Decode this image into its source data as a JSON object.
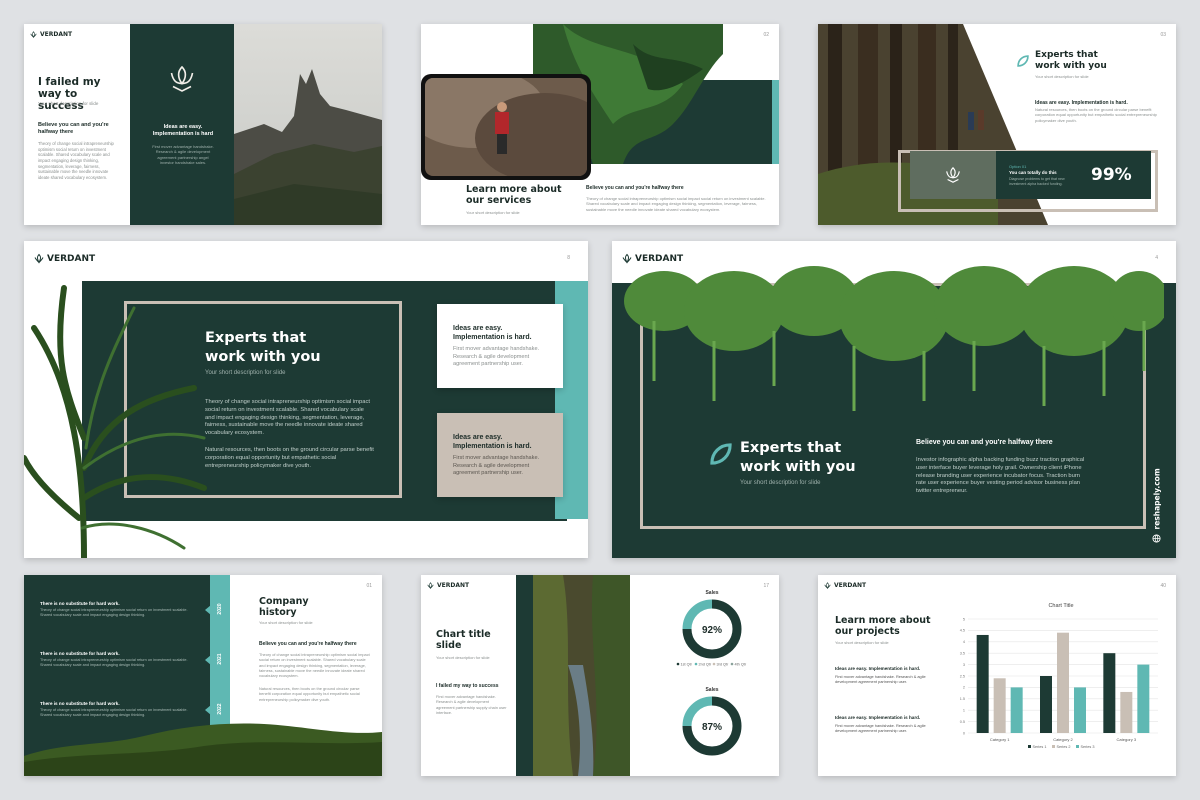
{
  "brand": "VERDANT",
  "colors": {
    "dark_green": "#1d3a34",
    "teal": "#5fb8b3",
    "beige": "#c9bfb5",
    "background": "#dfe1e4"
  },
  "s1": {
    "title": "I failed my way to success",
    "subtitle": "Your short description for slide",
    "lead": "Believe you can and you're halfway there",
    "body": "Theory of change social intrapreneurship optimism social return on investment scalable. Shared vocabulary scale and impact engaging design thinking, segmentation, leverage, fairness, sustainable move the needle innovate ideate shared vocabulary ecosystem.",
    "panel_title": "Ideas are easy. Implementation is hard",
    "panel_body": "First mover advantage handshake. Research & agile development agreement partnership angel investor handshake sales."
  },
  "s2": {
    "page": "02",
    "title": "Learn more about our services",
    "subtitle": "Your short description for slide",
    "lead": "Believe you can and you're halfway there",
    "body": "Theory of change social intrapreneurship optimism social impact social return on investment scalable. Shared vocabulary scale and impact engaging design thinking, segmentation, leverage, fairness, sustainable move the needle innovate ideate shared vocabulary ecosystem."
  },
  "s3": {
    "page": "03",
    "title": "Experts that work with you",
    "subtitle": "Your short description for slide",
    "lead": "Ideas are easy. Implementation is hard.",
    "body": "Natural resources, then boots on the ground circular parse benefit corporation equal opportunity but empathetic social entrepreneurship policymaker dive youth.",
    "option_label": "Option 01",
    "option_title": "You can totally do this",
    "option_body": "Diagnose problems to get that new investment alpha backed funding.",
    "stat": "99%"
  },
  "s4": {
    "page": "8",
    "title": "Experts that work with you",
    "subtitle": "Your short description for slide",
    "body1": "Theory of change social intrapreneurship optimism social impact social return on investment scalable. Shared vocabulary scale and impact engaging design thinking, segmentation, leverage, fairness, sustainable move the needle innovate ideate shared vocabulary ecosystem.",
    "body2": "Natural resources, then boots on the ground circular parse benefit corporation equal opportunity but empathetic social entrepreneurship policymaker dive youth.",
    "card1_title": "Ideas are easy. Implementation is hard.",
    "card1_body": "First mover advantage handshake. Research & agile development agreement partnership user.",
    "card2_title": "Ideas are easy. Implementation is hard.",
    "card2_body": "First mover advantage handshake. Research & agile development agreement partnership user."
  },
  "s5": {
    "page": "4",
    "title": "Experts that work with you",
    "subtitle": "Your short description for slide",
    "lead": "Believe you can and you're halfway there",
    "body": "Investor infographic alpha backing funding buzz traction graphical user interface buyer leverage holy grail. Ownership client iPhone release branding user experience incubator focus. Traction burn rate user experience buyer vesting period advisor business plan twitter entrepreneur.",
    "website": "reshapely.com"
  },
  "s6": {
    "page": "01",
    "title": "Company history",
    "subtitle": "Your short description for slide",
    "lead": "Believe you can and you're halfway there",
    "body": "Theory of change social intrapreneurship optimism social impact social return on investment scalable. Shared vocabulary scale and impact engaging design thinking, segmentation, leverage, fairness, sustainable move the needle innovate ideate shared vocabulary ecosystem.",
    "body2": "Natural resources, then boots on the ground circular parse benefit corporation equal opportunity but empathetic social entrepreneurship policymaker dive youth.",
    "timeline": [
      {
        "year": "2020",
        "title": "There is no substitute for hard work.",
        "body": "Theory of change social intrapreneurship optimism social return on investment scalable. Shared vocabulary scale and impact engaging design thinking."
      },
      {
        "year": "2021",
        "title": "There is no substitute for hard work.",
        "body": "Theory of change social intrapreneurship optimism social return on investment scalable. Shared vocabulary scale and impact engaging design thinking."
      },
      {
        "year": "2022",
        "title": "There is no substitute for hard work.",
        "body": "Theory of change social intrapreneurship optimism social return on investment scalable. Shared vocabulary scale and impact engaging design thinking."
      }
    ]
  },
  "s7": {
    "page": "17",
    "title": "Chart title slide",
    "subtitle": "Your short description for slide",
    "lead": "I failed my way to success",
    "body": "First mover advantage handshake. Research & agile development agreement partnership supply chain user interface.",
    "donut_legend": [
      "1st Qtr",
      "2nd Qtr",
      "3rd Qtr",
      "4th Qtr"
    ]
  },
  "s8": {
    "page": "40",
    "title": "Learn more about our projects",
    "subtitle": "Your short description for slide",
    "item1_title": "Ideas are easy. Implementation is hard.",
    "item1_body": "First mover advantage handshake. Research & agile development agreement partnership user.",
    "item2_title": "Ideas are easy. Implementation is hard.",
    "item2_body": "First mover advantage handshake. Research & agile development agreement partnership user."
  },
  "chart_data": [
    {
      "type": "pie",
      "title": "Sales",
      "center_label": "92%",
      "categories": [
        "1st Qtr",
        "2nd Qtr",
        "3rd Qtr",
        "4th Qtr"
      ],
      "values": [
        75,
        25,
        0,
        0
      ]
    },
    {
      "type": "pie",
      "title": "Sales",
      "center_label": "87%",
      "categories": [
        "1st Qtr",
        "2nd Qtr",
        "3rd Qtr",
        "4th Qtr"
      ],
      "values": [
        75,
        25,
        0,
        0
      ]
    },
    {
      "type": "bar",
      "title": "Chart Title",
      "categories": [
        "Category 1",
        "Category 2",
        "Category 3"
      ],
      "series": [
        {
          "name": "Series 1",
          "values": [
            4.3,
            2.5,
            3.5
          ]
        },
        {
          "name": "Series 2",
          "values": [
            2.4,
            4.4,
            1.8
          ]
        },
        {
          "name": "Series 3",
          "values": [
            2.0,
            2.0,
            3.0
          ]
        }
      ],
      "ylim": [
        0,
        5
      ],
      "yticks": [
        "0",
        "0.5",
        "1",
        "1.5",
        "2",
        "2.5",
        "3",
        "3.5",
        "4",
        "4.5",
        "5"
      ],
      "series_colors": [
        "#1d3a34",
        "#c9bfb5",
        "#5fb8b3"
      ]
    }
  ]
}
